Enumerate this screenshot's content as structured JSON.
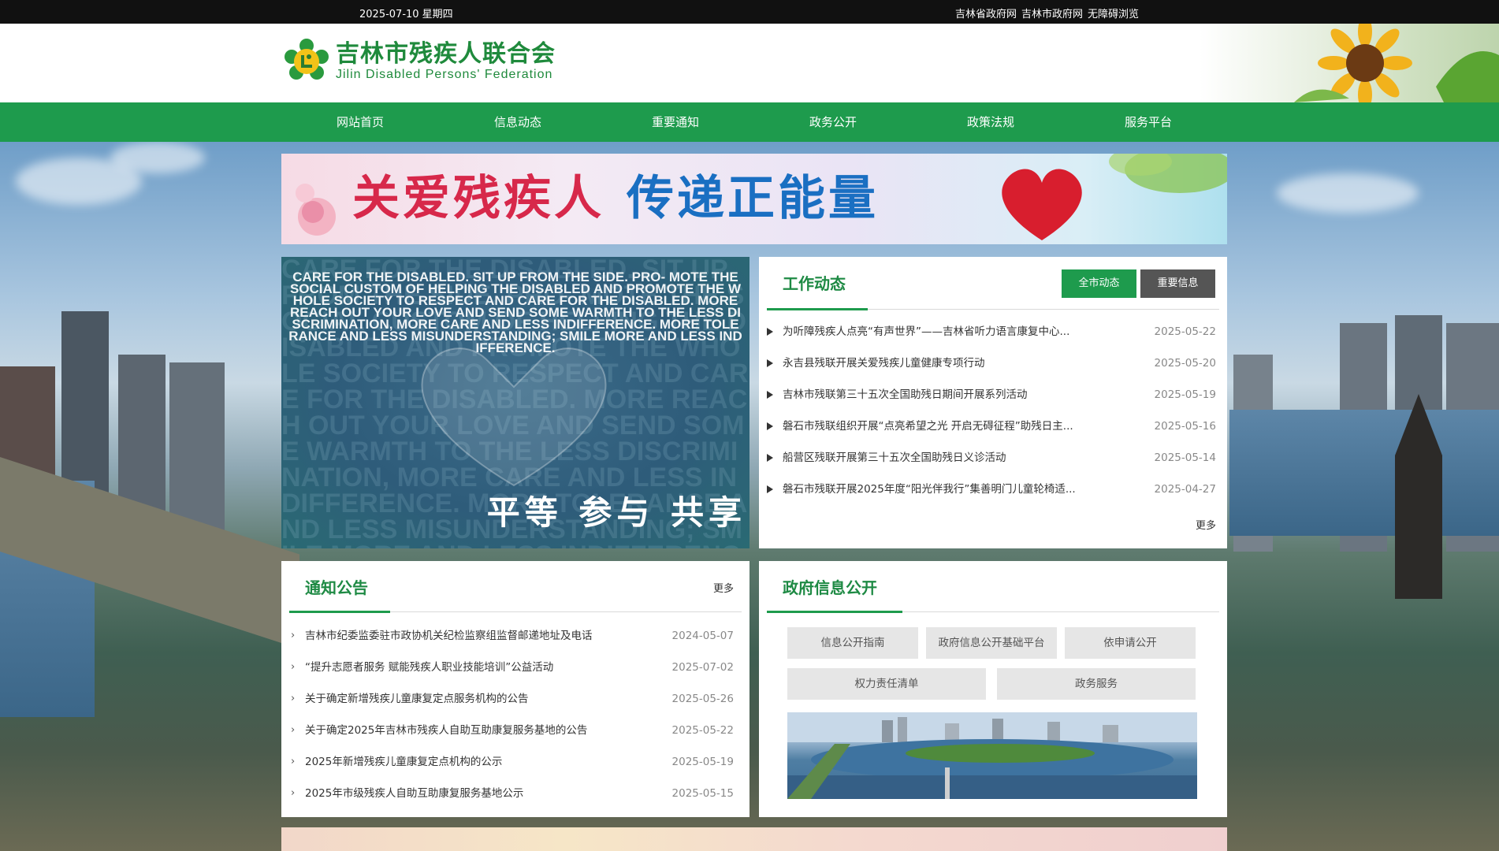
{
  "topbar": {
    "date": "2025-07-10 星期四",
    "links": [
      "吉林省政府网",
      "吉林市政府网",
      "无障碍浏览"
    ]
  },
  "logo": {
    "cn": "吉林市残疾人联合会",
    "en": "Jilin Disabled Persons' Federation"
  },
  "nav": [
    "网站首页",
    "信息动态",
    "重要通知",
    "政务公开",
    "政策法规",
    "服务平台"
  ],
  "banner": {
    "slogan_left": "关爱残疾人",
    "slogan_right": "传递正能量"
  },
  "hero": {
    "caption": "平等 参与 共享",
    "wordcloud": "CARE FOR THE DISABLED. SIT UP FROM THE SIDE. PRO- MOTE THE SOCIAL CUSTOM OF HELPING THE DISABLED AND PROMOTE THE WHOLE SOCIETY TO RESPECT AND CARE FOR THE DISABLED. MORE REACH OUT YOUR LOVE AND SEND SOME WARMTH TO THE LESS DISCRIMINATION, MORE CARE AND LESS INDIFFERENCE. MORE TOLERANCE AND LESS MISUNDERSTANDING; SMILE MORE AND LESS INDIFFERENCE."
  },
  "work": {
    "title": "工作动态",
    "tabs": [
      "全市动态",
      "重要信息"
    ],
    "items": [
      {
        "title": "为听障残疾人点亮“有声世界”——吉林省听力语言康复中心...",
        "date": "2025-05-22"
      },
      {
        "title": "永吉县残联开展关爱残疾儿童健康专项行动",
        "date": "2025-05-20"
      },
      {
        "title": "吉林市残联第三十五次全国助残日期间开展系列活动",
        "date": "2025-05-19"
      },
      {
        "title": "磐石市残联组织开展“点亮希望之光 开启无碍征程”助残日主...",
        "date": "2025-05-16"
      },
      {
        "title": "船营区残联开展第三十五次全国助残日义诊活动",
        "date": "2025-05-14"
      },
      {
        "title": "磐石市残联开展2025年度“阳光伴我行”集善明门儿童轮椅适...",
        "date": "2025-04-27"
      }
    ],
    "more": "更多"
  },
  "notice": {
    "title": "通知公告",
    "more": "更多",
    "items": [
      {
        "title": "吉林市纪委监委驻市政协机关纪检监察组监督邮递地址及电话",
        "date": "2024-05-07"
      },
      {
        "title": "“提升志愿者服务 赋能残疾人职业技能培训”公益活动",
        "date": "2025-07-02"
      },
      {
        "title": "关于确定新增残疾儿童康复定点服务机构的公告",
        "date": "2025-05-26"
      },
      {
        "title": "关于确定2025年吉林市残疾人自助互助康复服务基地的公告",
        "date": "2025-05-22"
      },
      {
        "title": "2025年新增残疾儿童康复定点机构的公示",
        "date": "2025-05-19"
      },
      {
        "title": "2025年市级残疾人自助互助康复服务基地公示",
        "date": "2025-05-15"
      }
    ]
  },
  "gov": {
    "title": "政府信息公开",
    "buttons_row1": [
      "信息公开指南",
      "政府信息公开基础平台",
      "依申请公开"
    ],
    "buttons_row2": [
      "权力责任清单",
      "政务服务"
    ]
  },
  "colors": {
    "brand_green": "#1e9b4d",
    "title_green": "#1e8a44",
    "topbar": "#111111",
    "gray_tab": "#555555"
  }
}
